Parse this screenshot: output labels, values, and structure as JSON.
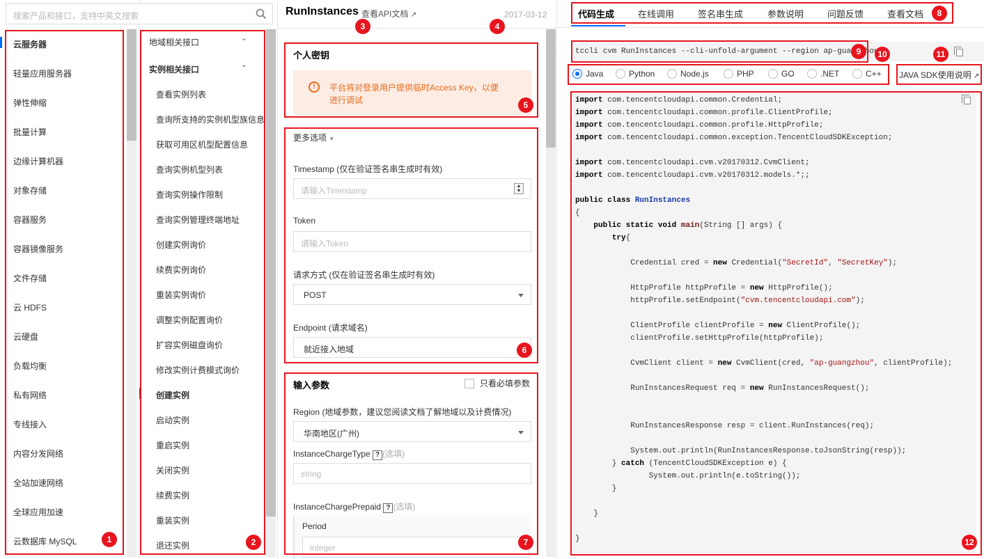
{
  "search": {
    "placeholder": "搜索产品和接口，支持中英文搜索"
  },
  "products": [
    "云服务器",
    "轻量应用服务器",
    "弹性伸缩",
    "批量计算",
    "边缘计算机器",
    "对象存储",
    "容器服务",
    "容器镜像服务",
    "文件存储",
    "云 HDFS",
    "云硬盘",
    "负载均衡",
    "私有网络",
    "专线接入",
    "内容分发网络",
    "全站加速网络",
    "全球应用加速",
    "云数据库 MySQL"
  ],
  "interfaces": {
    "group1": "地域相关接口",
    "group2": "实例相关接口",
    "items": [
      "查看实例列表",
      "查询所支持的实例机型族信息",
      "获取可用区机型配置信息",
      "查询实例机型列表",
      "查询实例操作限制",
      "查询实例管理终端地址",
      "创建实例询价",
      "续费实例询价",
      "重装实例询价",
      "调整实例配置询价",
      "扩容实例磁盘询价",
      "修改实例计费模式询价",
      "创建实例",
      "启动实例",
      "重启实例",
      "关闭实例",
      "续费实例",
      "重装实例",
      "退还实例"
    ],
    "active_item": "创建实例"
  },
  "api": {
    "title": "RunInstances",
    "doc_link": "查看API文档",
    "date": "2017-03-12"
  },
  "secret": {
    "title": "个人密钥",
    "notice": "平台将对登录用户提供临时Access Key，以便进行调试"
  },
  "options": {
    "toggle": "更多选项",
    "timestamp_label": "Timestamp (仅在验证签名串生成时有效)",
    "timestamp_ph": "请输入Timestamp",
    "token_label": "Token",
    "token_ph": "请输入Token",
    "method_label": "请求方式 (仅在验证签名串生成时有效)",
    "method_value": "POST",
    "endpoint_label": "Endpoint (请求域名)",
    "endpoint_value": "就近接入地域"
  },
  "params": {
    "title": "输入参数",
    "required_only": "只看必填参数",
    "region_label": "Region (地域参数，建议您阅读文档了解地域以及计费情况)",
    "region_value": "华南地区(广州)",
    "charge_type_label": "InstanceChargeType",
    "charge_type_opt": "(选填)",
    "charge_type_ph": "string",
    "prepaid_label": "InstanceChargePrepaid",
    "prepaid_opt": "(选填)",
    "period_label": "Period",
    "period_ph": "integer"
  },
  "tabs": [
    "代码生成",
    "在线调用",
    "签名串生成",
    "参数说明",
    "问题反馈",
    "查看文档"
  ],
  "cli": "tccli cvm RunInstances --cli-unfold-argument --region ap-guangzhou",
  "languages": [
    "Java",
    "Python",
    "Node.js",
    "PHP",
    "GO",
    ".NET",
    "C++"
  ],
  "sdk_link": "JAVA SDK使用说明",
  "badges": [
    "1",
    "2",
    "3",
    "4",
    "5",
    "6",
    "7",
    "8",
    "9",
    "10",
    "11",
    "12"
  ],
  "colors": {
    "accent": "#006eff",
    "annotation": "#e8141e",
    "notice_bg": "#fdece3",
    "notice_icon": "#e86a1b"
  }
}
